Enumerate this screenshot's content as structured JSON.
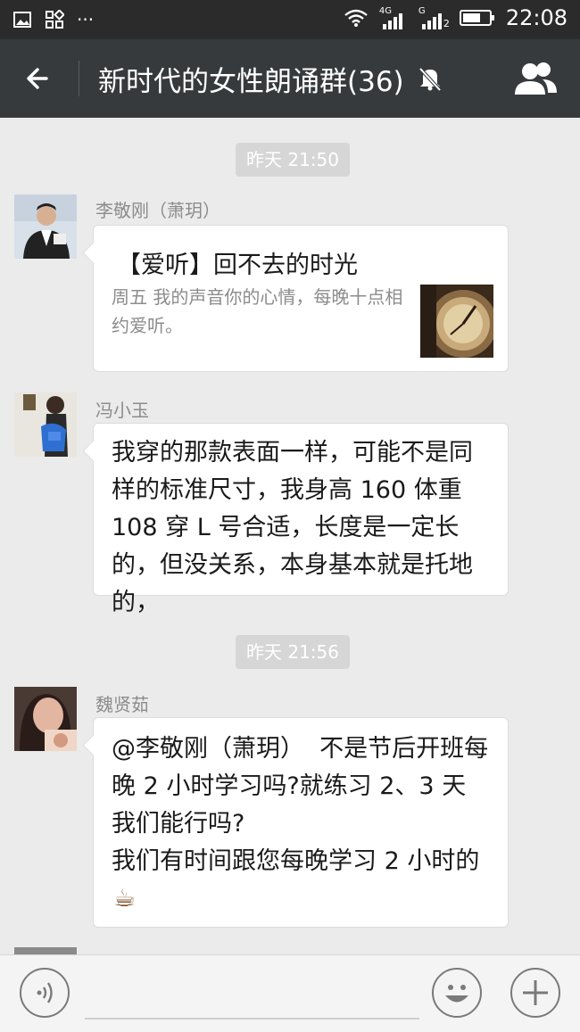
{
  "status_bar": {
    "time": "22:08",
    "net1": "4G",
    "net2": "G",
    "sim_label": "2"
  },
  "header": {
    "title": "新时代的女性朗诵群(36)"
  },
  "timestamps": [
    "昨天 21:50",
    "昨天 21:56"
  ],
  "messages": [
    {
      "sender": "李敬刚（萧玥）",
      "card_title": "【爱听】回不去的时光",
      "card_desc": "周五   我的声音你的心情，每晚十点相约爱听。"
    },
    {
      "sender": "冯小玉",
      "text": "我穿的那款表面一样，可能不是同样的标准尺寸，我身高 160 体重 108 穿 L 号合适，长度是一定长的，但没关系，本身基本就是托地的，"
    },
    {
      "sender": "魏贤茹",
      "text": "@李敬刚（萧玥）  不是节后开班每晚 2 小时学习吗?就练习 2、3 天我们能行吗?\n我们有时间跟您每晚学习 2 小时的",
      "emoji": "☕"
    }
  ]
}
